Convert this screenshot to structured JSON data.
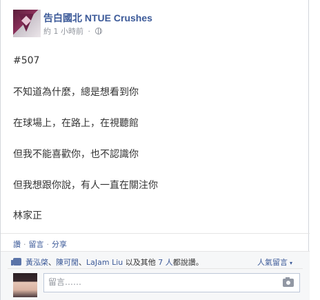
{
  "post": {
    "page_name": "告白國北 NTUE Crushes",
    "timestamp": "約 1 小時前",
    "meta_separator": "·",
    "lines": [
      "#507",
      "不知道為什麼，總是想看到你",
      "在球場上，在路上，在視聽館",
      "但我不能喜歡你，也不認識你",
      "但我想跟你說，有人一直在關注你",
      "林家正"
    ]
  },
  "actions": {
    "like": "讚",
    "comment": "留言",
    "share": "分享",
    "separator": "·"
  },
  "likes": {
    "name1": "黃泓棨",
    "sep": "、",
    "name2": "陳可閒",
    "name3": "LaJam Liu",
    "suffix_pre": "以及其他",
    "others": "7 人",
    "suffix_post": "都說讚。"
  },
  "popular": {
    "label": "人氣留言",
    "caret": "▾"
  },
  "comment": {
    "placeholder": "留言……"
  },
  "colors": {
    "link": "#3b5998",
    "muted": "#90949c",
    "footer_bg": "#f6f7f8"
  },
  "icons": [
    "globe-icon",
    "thumb-up-icon",
    "camera-icon"
  ]
}
